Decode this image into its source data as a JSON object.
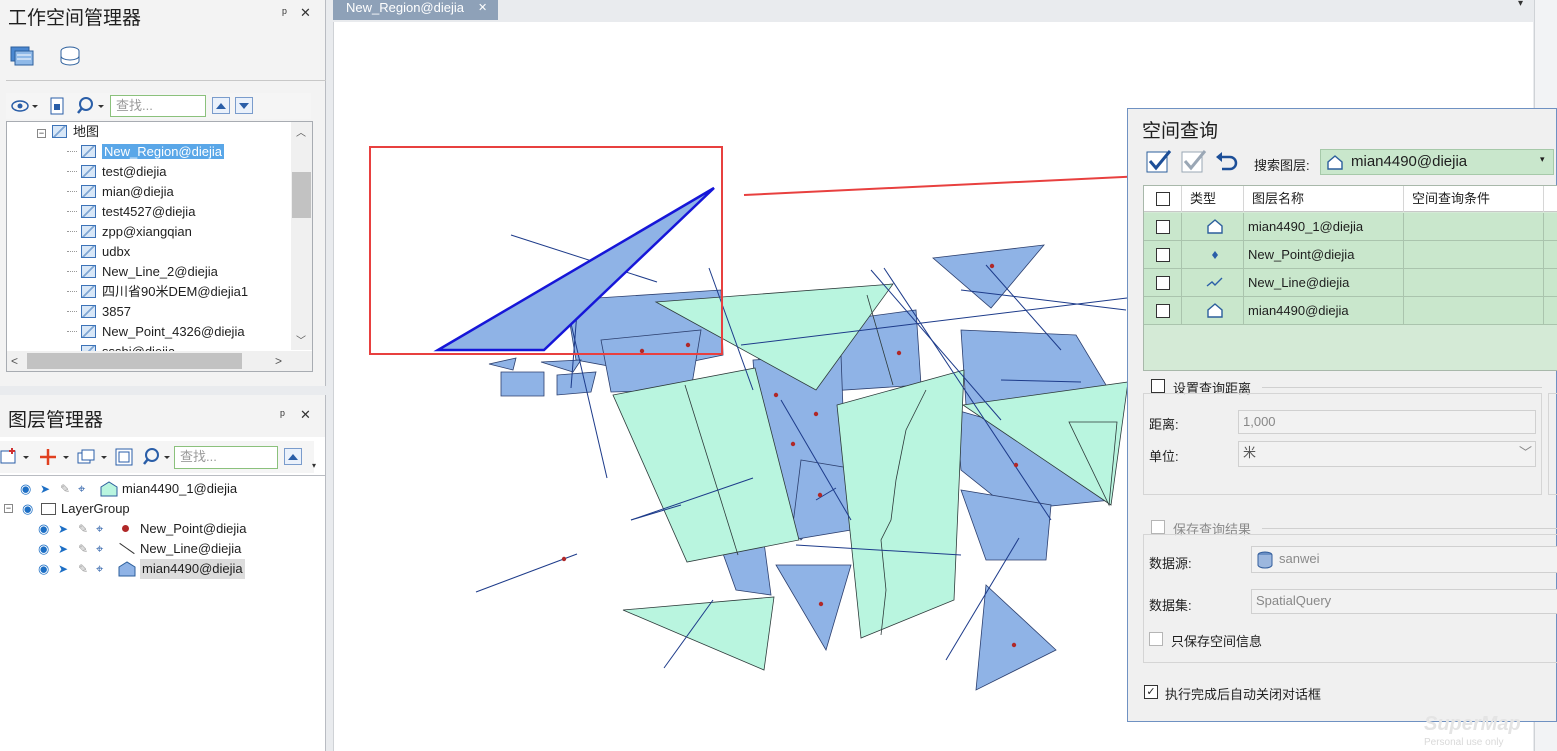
{
  "workspace_panel": {
    "title": "工作空间管理器",
    "pin": "ᵖ",
    "close": "✕",
    "search_placeholder": "查找...",
    "tree": {
      "root": "地图",
      "items": [
        "New_Region@diejia",
        "test@diejia",
        "mian@diejia",
        "test4527@diejia",
        "zpp@xiangqian",
        "udbx",
        "New_Line_2@diejia",
        "四川省90米DEM@diejia1",
        "3857",
        "New_Point_4326@diejia",
        "ssshi@diejia"
      ],
      "selected_index": 0
    }
  },
  "layer_panel": {
    "title": "图层管理器",
    "pin": "ᵖ",
    "close": "✕",
    "search_placeholder": "查找...",
    "layers": [
      {
        "name": "mian4490_1@diejia",
        "indent": 0,
        "kind": "region"
      },
      {
        "name": "LayerGroup",
        "indent": 0,
        "kind": "group"
      },
      {
        "name": "New_Point@diejia",
        "indent": 1,
        "kind": "point"
      },
      {
        "name": "New_Line@diejia",
        "indent": 1,
        "kind": "line"
      },
      {
        "name": "mian4490@diejia",
        "indent": 1,
        "kind": "region",
        "selected": true
      }
    ]
  },
  "map": {
    "tab_label": "New_Region@diejia",
    "tab_close": "✕"
  },
  "dialog": {
    "title": "空间查询",
    "search_layer_label": "搜索图层:",
    "search_layer_value": "mian4490@diejia",
    "grid": {
      "headers": [
        "类型",
        "图层名称",
        "空间查询条件"
      ],
      "rows": [
        {
          "type_icon": "region-icon",
          "name": "mian4490_1@diejia",
          "condition": ""
        },
        {
          "type_icon": "point-icon",
          "name": "New_Point@diejia",
          "condition": ""
        },
        {
          "type_icon": "line-icon",
          "name": "New_Line@diejia",
          "condition": ""
        },
        {
          "type_icon": "region-icon",
          "name": "mian4490@diejia",
          "condition": ""
        }
      ]
    },
    "distance_section": {
      "label": "设置查询距离",
      "distance_label": "距离:",
      "distance_value": "1,000",
      "unit_label": "单位:",
      "unit_value": "米"
    },
    "save_section": {
      "label": "保存查询结果",
      "datasource_label": "数据源:",
      "datasource_value": "sanwei",
      "dataset_label": "数据集:",
      "dataset_value": "SpatialQuery",
      "spatial_only_label": "只保存空间信息"
    },
    "auto_close_label": "执行完成后自动关闭对话框",
    "auto_close_checked": true
  },
  "watermark": {
    "brand": "SuperMap",
    "sub": "Personal use only"
  },
  "colors": {
    "region_blue": "#8fb3e6",
    "region_green": "#b9f5df",
    "highlight_red": "#e8403f",
    "selection_blue": "#1616d8"
  }
}
